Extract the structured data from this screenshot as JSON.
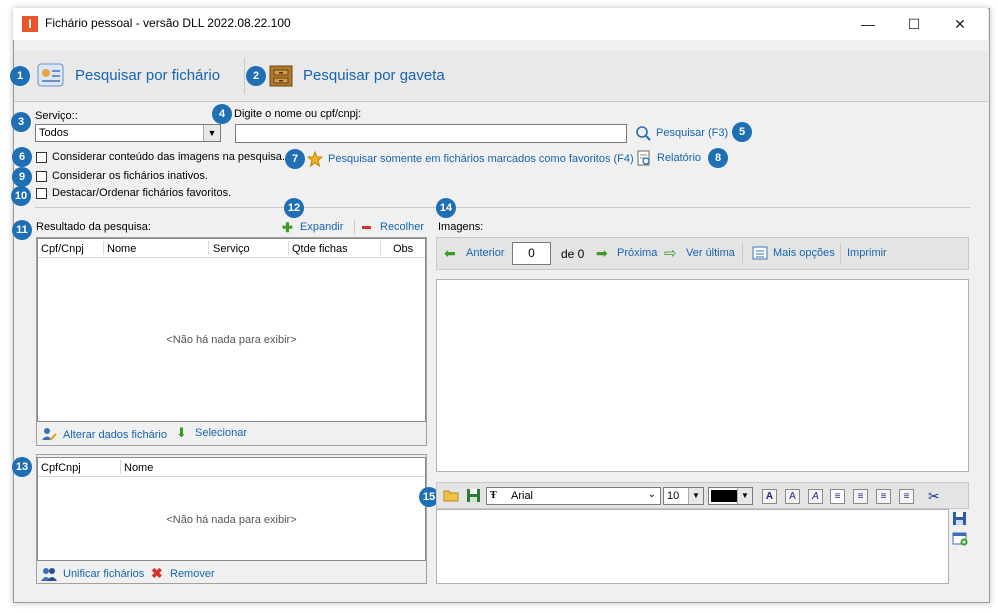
{
  "window": {
    "title": "Fichário pessoal - versão DLL 2022.08.22.100",
    "minimize": "—",
    "maximize": "☐",
    "close": "✕"
  },
  "tabs": {
    "by_fichario": "Pesquisar por fichário",
    "by_gaveta": "Pesquisar por gaveta"
  },
  "badges": [
    "1",
    "2",
    "3",
    "4",
    "5",
    "6",
    "7",
    "8",
    "9",
    "10",
    "11",
    "12",
    "13",
    "14",
    "15"
  ],
  "search": {
    "service_label": "Serviço::",
    "service_value": "Todos",
    "name_label": "Digite o nome ou cpf/cnpj:",
    "name_value": "",
    "search_button": "Pesquisar (F3)",
    "favorites_only": "Pesquisar somente em fichários marcados como favoritos (F4)",
    "report": "Relatório",
    "opt_images": "Considerar conteúdo das imagens na pesquisa.",
    "opt_inactive": "Considerar os fichários inativos.",
    "opt_favorites": "Destacar/Ordenar fichários favoritos."
  },
  "results": {
    "label": "Resultado da pesquisa:",
    "expand": "Expandir",
    "collapse": "Recolher",
    "columns": [
      "Cpf/Cnpj",
      "Nome",
      "Serviço",
      "Qtde fichas",
      "Obs"
    ],
    "empty": "<Não há nada para exibir>",
    "alter": "Alterar dados fichário",
    "select": "Selecionar"
  },
  "bottom_list": {
    "columns": [
      "CpfCnpj",
      "Nome"
    ],
    "empty": "<Não há nada para exibir>",
    "unify": "Unificar fichários",
    "remove": "Remover"
  },
  "images": {
    "label": "Imagens:",
    "previous": "Anterior",
    "page": "0",
    "of": "de 0",
    "next": "Próxima",
    "last": "Ver última",
    "more": "Mais opções",
    "print": "Imprimir"
  },
  "editor": {
    "font": "Arial",
    "size": "10",
    "color": "#000000"
  }
}
